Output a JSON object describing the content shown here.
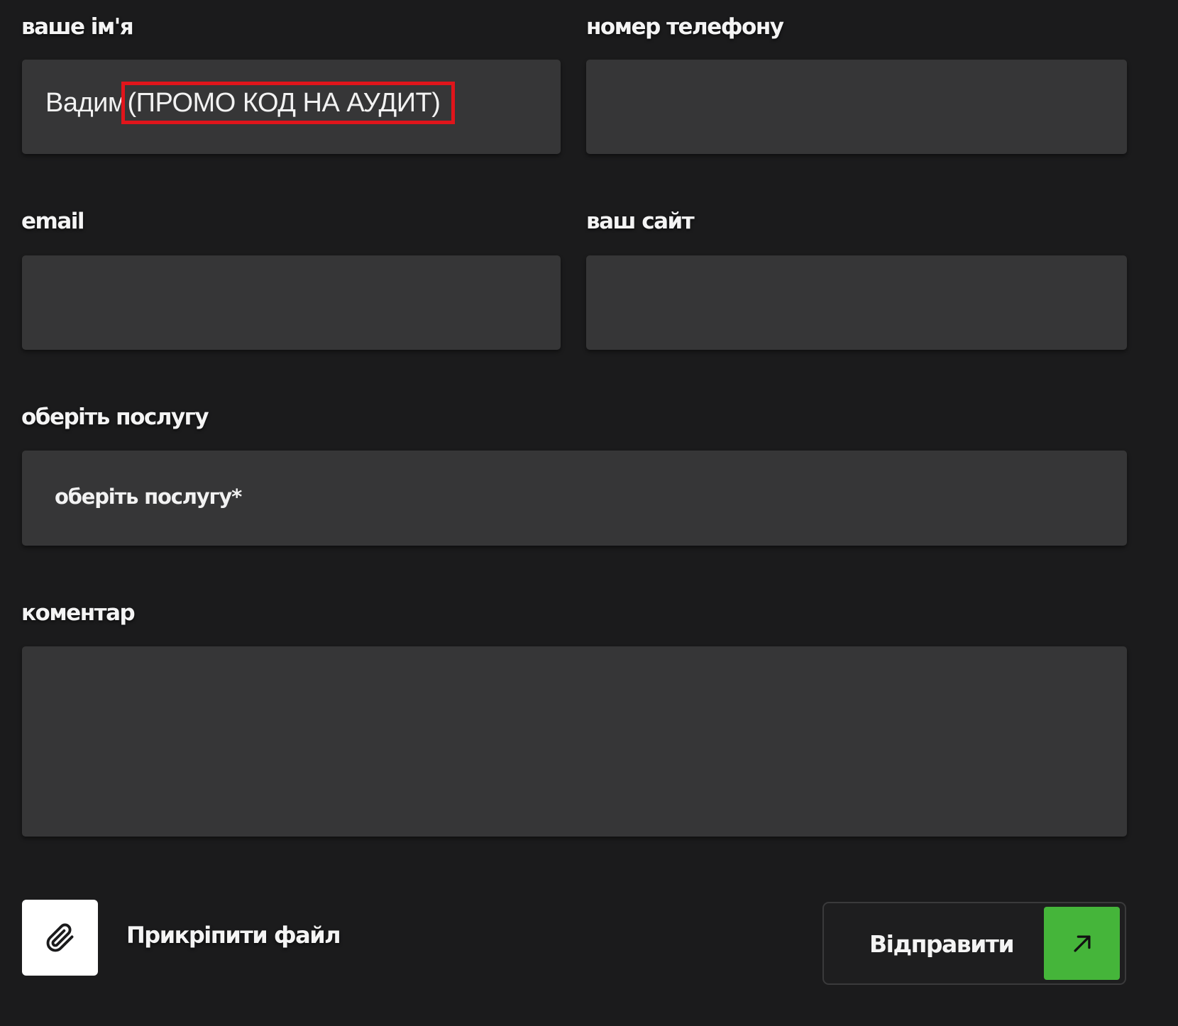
{
  "form": {
    "name": {
      "label": "ваше ім'я",
      "value_name": "Вадим",
      "value_promo": "(ПРОМО КОД НА АУДИТ)"
    },
    "phone": {
      "label": "номер телефону",
      "value": ""
    },
    "email": {
      "label": "email",
      "value": ""
    },
    "site": {
      "label": "ваш сайт",
      "value": ""
    },
    "service": {
      "label": "оберіть послугу",
      "selected": "оберіть послугу*"
    },
    "comment": {
      "label": "коментар",
      "value": ""
    }
  },
  "actions": {
    "attach_label": "Прикріпити файл",
    "attach_icon": "paperclip-icon",
    "submit_label": "Відправити",
    "submit_icon": "arrow-up-right-icon"
  },
  "colors": {
    "background": "#1b1b1c",
    "field": "#363637",
    "highlight": "#e0151b",
    "accent": "#45b53a"
  }
}
